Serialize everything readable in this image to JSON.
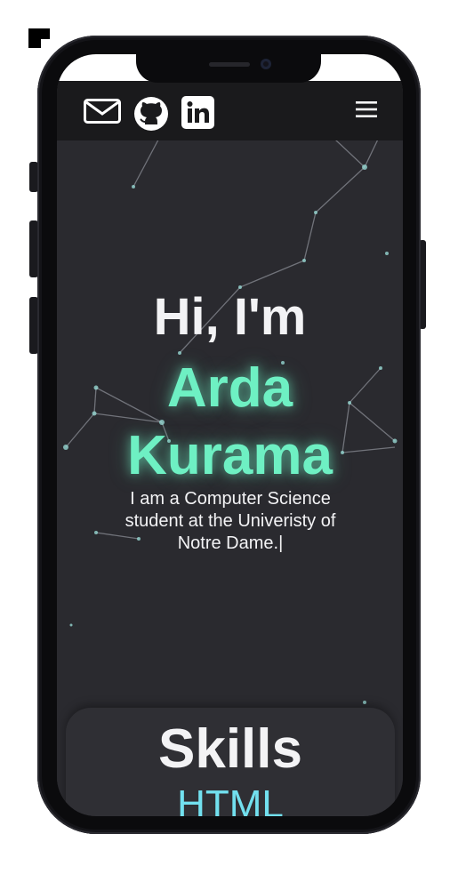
{
  "colors": {
    "background": "#2a2a2f",
    "navbar": "#1a1a1c",
    "accent_name": "#6ef0c3",
    "accent_skill": "#72e0ef",
    "text": "#f3f3f5"
  },
  "nav": {
    "icons": [
      "mail-icon",
      "github-icon",
      "linkedin-icon",
      "menu-icon"
    ]
  },
  "hero": {
    "greeting": "Hi, I'm",
    "first_name": "Arda",
    "last_name": "Kurama",
    "description": "I am a Computer Science student at the Univeristy of Notre Dame.",
    "cursor": "|"
  },
  "skills": {
    "title": "Skills",
    "first_item": "HTML"
  }
}
